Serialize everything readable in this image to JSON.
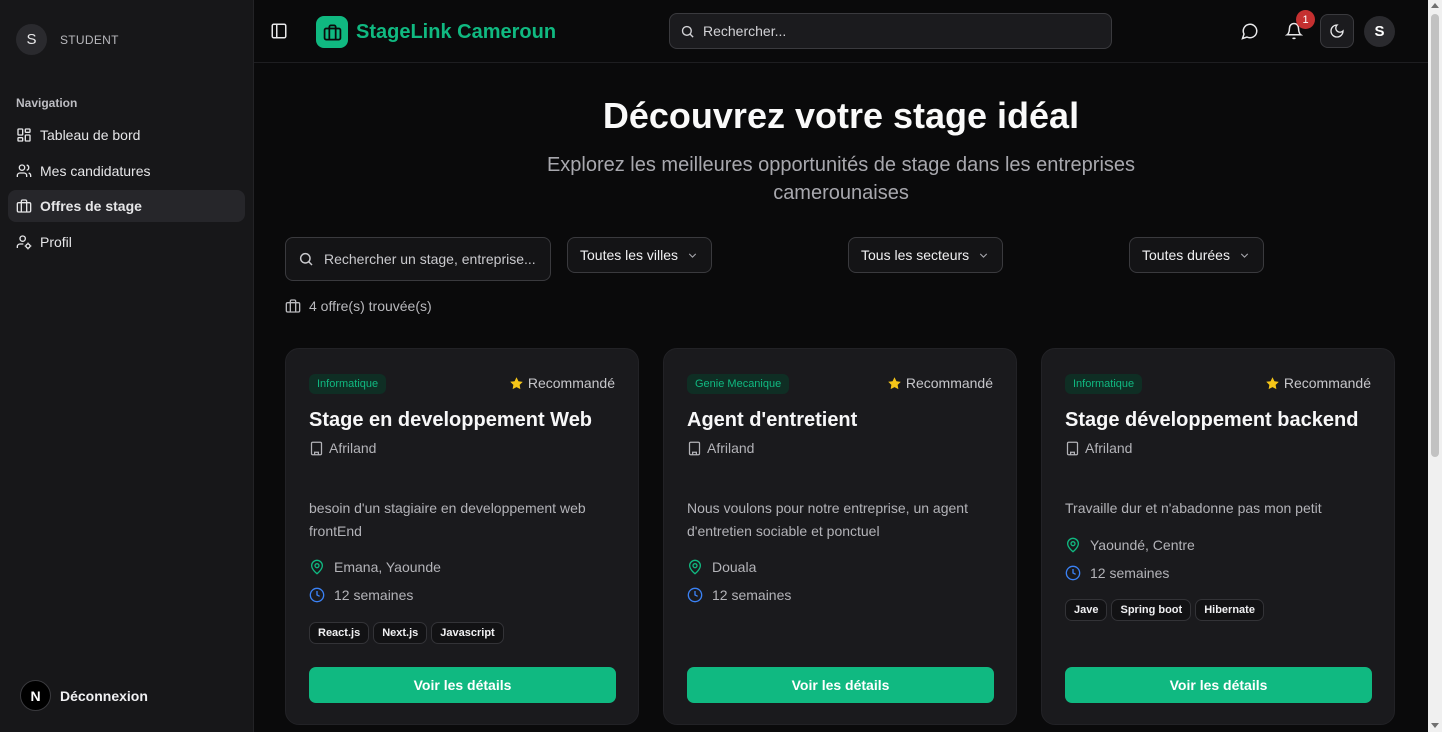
{
  "sidebar": {
    "user_initial": "S",
    "role": "STUDENT",
    "nav_heading": "Navigation",
    "items": [
      {
        "label": "Tableau de bord",
        "icon": "dashboard-icon"
      },
      {
        "label": "Mes candidatures",
        "icon": "users-icon"
      },
      {
        "label": "Offres de stage",
        "icon": "briefcase-icon",
        "active": true
      },
      {
        "label": "Profil",
        "icon": "user-cog-icon"
      }
    ],
    "logout_initial": "N",
    "logout_label": "Déconnexion"
  },
  "header": {
    "brand": "StageLink Cameroun",
    "search_placeholder": "Rechercher...",
    "notification_count": "1",
    "user_initial": "S"
  },
  "main": {
    "title": "Découvrez votre stage idéal",
    "subtitle": "Explorez les meilleures opportunités de stage dans les entreprises camerounaises",
    "search_placeholder": "Rechercher un stage, entreprise...",
    "filters": {
      "city": "Toutes les villes",
      "sector": "Tous les secteurs",
      "duration": "Toutes durées"
    },
    "results_count": "4 offre(s) trouvée(s)"
  },
  "cards": [
    {
      "category": "Informatique",
      "recommended": "Recommandé",
      "title": "Stage en developpement Web",
      "company": "Afriland",
      "description": "besoin d'un stagiaire en developpement web frontEnd",
      "location": "Emana, Yaounde",
      "duration": "12 semaines",
      "tags": [
        "React.js",
        "Next.js",
        "Javascript"
      ],
      "cta": "Voir les détails"
    },
    {
      "category": "Genie Mecanique",
      "recommended": "Recommandé",
      "title": "Agent d'entretient",
      "company": "Afriland",
      "description": "Nous voulons pour notre entreprise, un agent d'entretien sociable et ponctuel",
      "location": "Douala",
      "duration": "12 semaines",
      "tags": [],
      "cta": "Voir les détails"
    },
    {
      "category": "Informatique",
      "recommended": "Recommandé",
      "title": "Stage développement backend",
      "company": "Afriland",
      "description": "Travaille dur et n'abadonne pas mon petit",
      "location": "Yaoundé, Centre",
      "duration": "12 semaines",
      "tags": [
        "Jave",
        "Spring boot",
        "Hibernate"
      ],
      "cta": "Voir les détails"
    }
  ],
  "colors": {
    "accent": "#10b981",
    "star": "#f5c518",
    "clock": "#3b82f6",
    "badge": "#c53030"
  }
}
